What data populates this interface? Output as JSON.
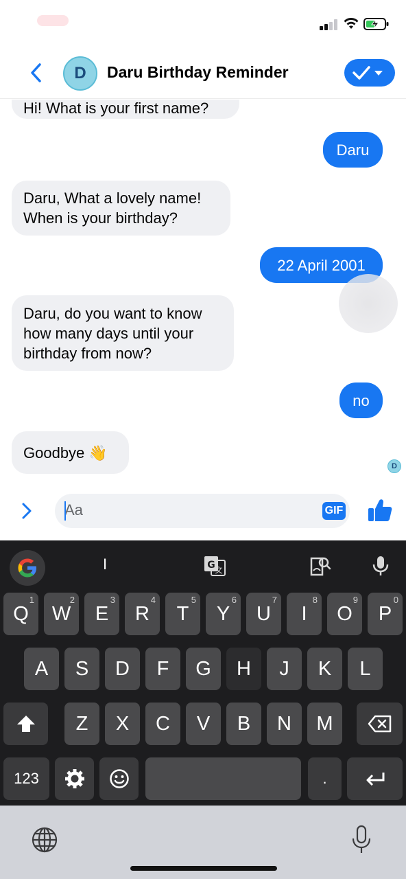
{
  "header": {
    "title": "Daru Birthday Reminder",
    "avatar_letter": "D"
  },
  "messages": [
    {
      "from": "bot",
      "text": "Hi! What is your first name?"
    },
    {
      "from": "user",
      "text": "Daru"
    },
    {
      "from": "bot",
      "text": "Daru, What a lovely name!\nWhen is your birthday?"
    },
    {
      "from": "user",
      "text": "22 April 2001"
    },
    {
      "from": "bot",
      "text": "Daru, do you want to know\nhow many days until your\nbirthday from now?"
    },
    {
      "from": "user",
      "text": "no"
    },
    {
      "from": "bot",
      "text": "Goodbye 👋"
    }
  ],
  "seen_avatar_letter": "D",
  "composer": {
    "placeholder": "Aa",
    "gif_label": "GIF"
  },
  "keyboard": {
    "suggestion": "I",
    "row1": [
      {
        "key": "Q",
        "num": "1"
      },
      {
        "key": "W",
        "num": "2"
      },
      {
        "key": "E",
        "num": "3"
      },
      {
        "key": "R",
        "num": "4"
      },
      {
        "key": "T",
        "num": "5"
      },
      {
        "key": "Y",
        "num": "6"
      },
      {
        "key": "U",
        "num": "7"
      },
      {
        "key": "I",
        "num": "8"
      },
      {
        "key": "O",
        "num": "9"
      },
      {
        "key": "P",
        "num": "0"
      }
    ],
    "row2": [
      "A",
      "S",
      "D",
      "F",
      "G",
      "H",
      "J",
      "K",
      "L"
    ],
    "row3": [
      "Z",
      "X",
      "C",
      "V",
      "B",
      "N",
      "M"
    ],
    "numbers_key": "123",
    "period_key": "."
  },
  "icons": {
    "back": "chevron-left-icon",
    "done": "check-dropdown-icon",
    "expand": "chevron-right-icon",
    "like": "thumbs-up-icon",
    "google": "google-g-icon",
    "translate": "translate-icon",
    "sticker": "sticker-search-icon",
    "mic": "microphone-icon",
    "shift": "shift-icon",
    "backspace": "backspace-icon",
    "settings": "gear-icon",
    "emoji": "emoji-icon",
    "enter": "enter-icon",
    "globe": "globe-icon"
  },
  "colors": {
    "accent": "#1877f2",
    "incoming_bubble": "#eff0f3",
    "keyboard_bg": "#1d1d1f"
  }
}
